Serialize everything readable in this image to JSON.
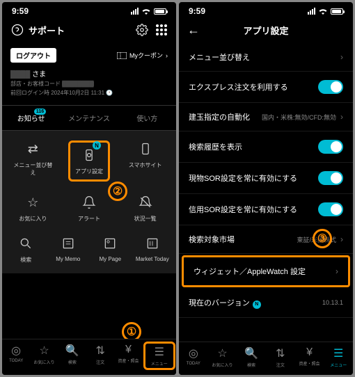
{
  "status": {
    "time": "9:59"
  },
  "left": {
    "header_title": "サポート",
    "logout": "ログアウト",
    "coupon": "Myクーポン",
    "user_suffix": "さま",
    "meta_label1": "部店・お客様コード",
    "meta_login": "前回ログイン時",
    "meta_login_time": "2024年10月2日 11:31",
    "tabs": {
      "notice": "お知らせ",
      "notice_badge": "116",
      "maintenance": "メンテナンス",
      "usage": "使い方"
    },
    "grid": {
      "reorder": "メニュー並び替え",
      "app_settings": "アプリ設定",
      "smartphone": "スマホサイト",
      "favorite": "お気に入り",
      "alert": "アラート",
      "status_list": "状況一覧",
      "search": "検索",
      "mymemo": "My Memo",
      "mypage": "My Page",
      "market": "Market Today"
    }
  },
  "right": {
    "title": "アプリ設定",
    "items": {
      "reorder": "メニュー並び替え",
      "express": "エクスプレス注文を利用する",
      "tatedama": "建玉指定の自動化",
      "tatedama_val": "国内・米株:無効/CFD:無効",
      "history": "検索履歴を表示",
      "sor_spot": "現物SOR設定を常に有効にする",
      "sor_margin": "信用SOR設定を常に有効にする",
      "market": "検索対象市場",
      "market_val": "東証/米国株式",
      "widget": "ウィジェット／AppleWatch 設定",
      "version": "現在のバージョン",
      "version_val": "10.13.1"
    }
  },
  "nav": {
    "today": "TODAY",
    "fav": "お気に入り",
    "search": "検索",
    "order": "注文",
    "balance": "資産・照会",
    "menu": "メニュー"
  }
}
